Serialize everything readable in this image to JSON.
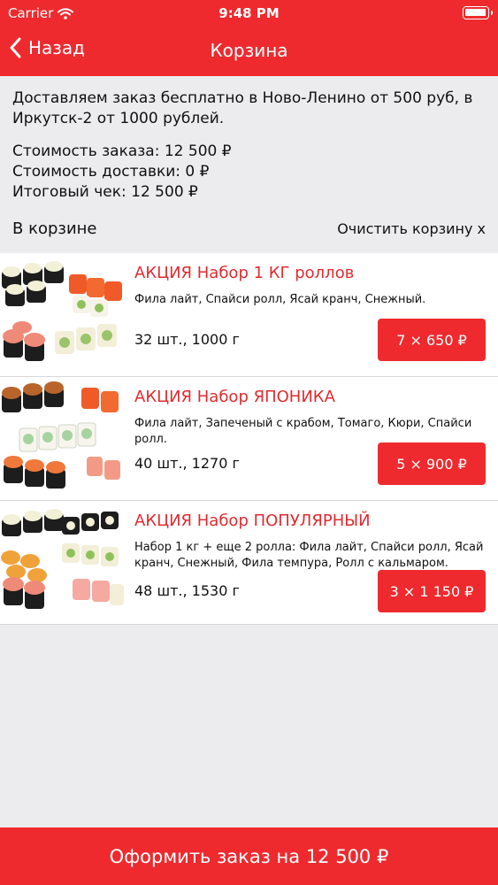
{
  "status_bar": {
    "carrier": "Carrier",
    "time": "9:48 PM"
  },
  "nav": {
    "back_label": "Назад",
    "title": "Корзина"
  },
  "info": {
    "delivery_note": "Доставляем заказ бесплатно в Ново-Ленино от 500 руб, в Иркутск-2 от 1000 рублей.",
    "order_cost": "Стоимость заказа: 12 500 ₽",
    "delivery_cost": "Стоимость доставки: 0 ₽",
    "total": "Итоговый чек: 12 500 ₽"
  },
  "cart": {
    "label": "В корзине",
    "clear_label": "Очистить корзину x"
  },
  "items": [
    {
      "name": "АКЦИЯ Набор 1 КГ роллов",
      "description": "Фила лайт, Спайси ролл, Ясай кранч, Снежный.",
      "meta": "32 шт., 1000 г",
      "price": "7 × 650 ₽"
    },
    {
      "name": "АКЦИЯ Набор ЯПОНИКА",
      "description": "Фила лайт, Запеченый с крабом, Томаго, Кюри, Спайси ролл.",
      "meta": "40 шт., 1270 г",
      "price": "5 × 900 ₽"
    },
    {
      "name": "АКЦИЯ Набор ПОПУЛЯРНЫЙ",
      "description": "Набор 1 кг + еще 2 ролла: Фила лайт, Спайси ролл, Ясай кранч, Снежный, Фила темпура, Ролл с кальмаром.",
      "meta": "48 шт., 1530 г",
      "price": "3 × 1 150 ₽"
    }
  ],
  "checkout_label": "Оформить заказ на 12 500 ₽",
  "colors": {
    "accent": "#ee2a2e",
    "item_title": "#e02b30",
    "background": "#ececee"
  },
  "icons": [
    "wifi-icon",
    "battery-icon",
    "back-chevron-icon",
    "sushi-set-image"
  ]
}
